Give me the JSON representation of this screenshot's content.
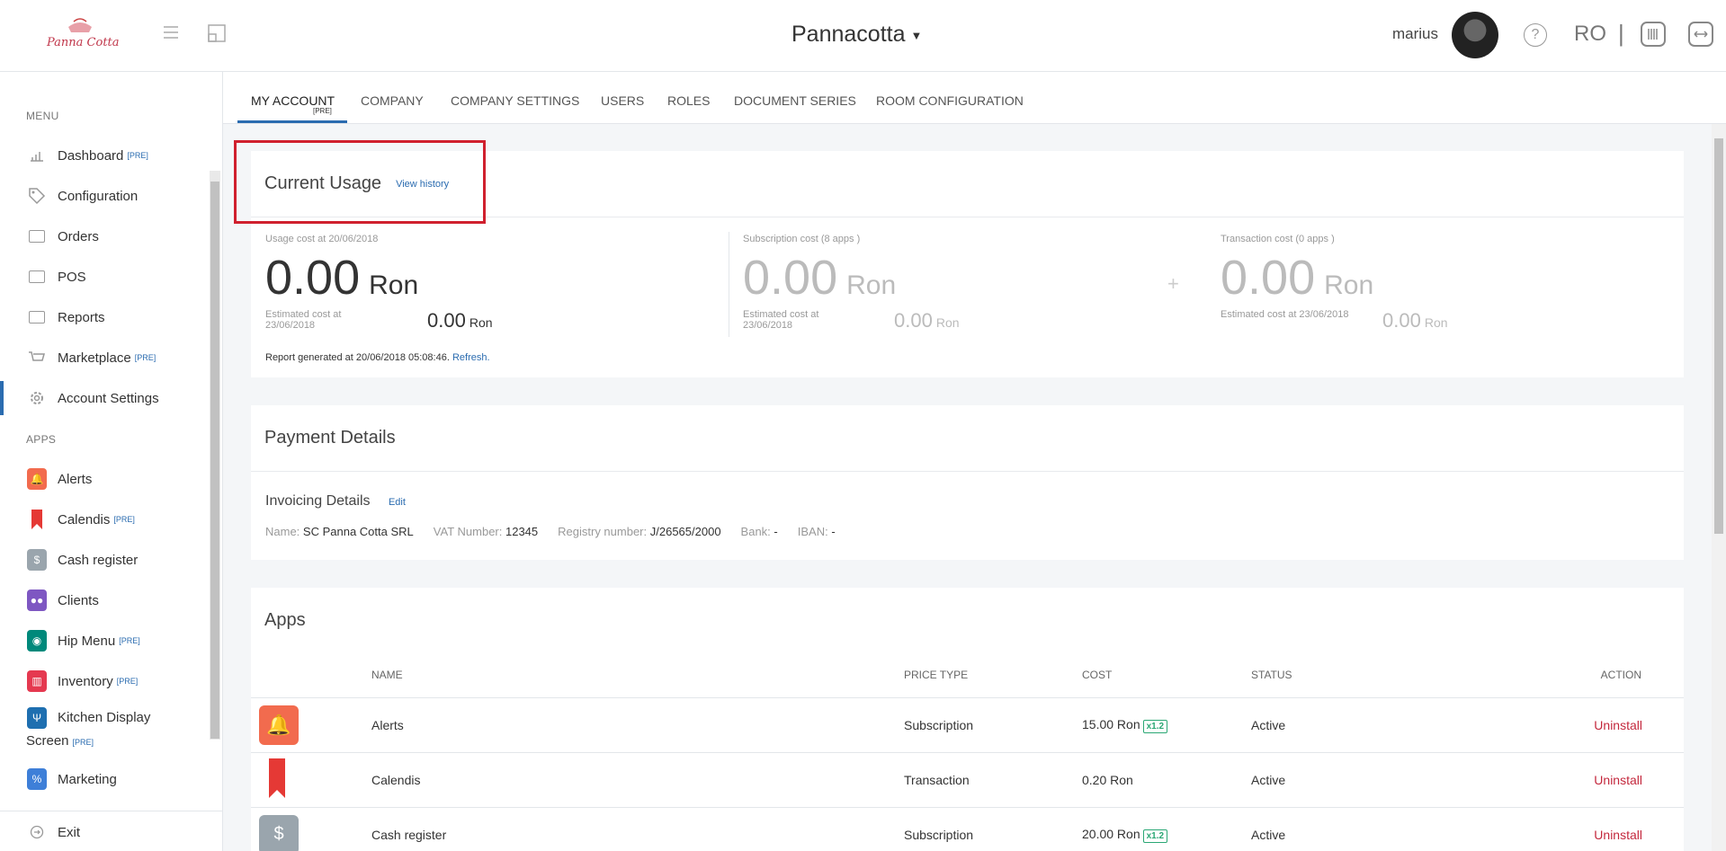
{
  "header": {
    "title": "Pannacotta",
    "user": "marius",
    "language": "RO",
    "separator": "|"
  },
  "sidebar": {
    "menu_label": "MENU",
    "apps_label": "APPS",
    "pre_tag": "[PRE]",
    "menu_items": [
      {
        "label": "Dashboard",
        "pre": true,
        "icon": "chart-icon"
      },
      {
        "label": "Configuration",
        "pre": false,
        "icon": "tag-icon"
      },
      {
        "label": "Orders",
        "pre": false,
        "icon": "orders-icon"
      },
      {
        "label": "POS",
        "pre": false,
        "icon": "pos-icon"
      },
      {
        "label": "Reports",
        "pre": false,
        "icon": "reports-icon"
      },
      {
        "label": "Marketplace",
        "pre": true,
        "icon": "cart-icon"
      },
      {
        "label": "Account Settings",
        "pre": false,
        "icon": "gear-icon",
        "active": true
      }
    ],
    "app_items": [
      {
        "label": "Alerts",
        "pre": false,
        "color": "#f26b4e"
      },
      {
        "label": "Calendis",
        "pre": true,
        "color": "#e53935"
      },
      {
        "label": "Cash register",
        "pre": false,
        "color": "#9aa5ad"
      },
      {
        "label": "Clients",
        "pre": false,
        "color": "#7e57c2"
      },
      {
        "label": "Hip Menu",
        "pre": true,
        "color": "#00897b"
      },
      {
        "label": "Inventory",
        "pre": true,
        "color": "#e53950"
      },
      {
        "label": "Kitchen Display",
        "label2": "Screen",
        "pre": true,
        "color": "#1e6fb0"
      },
      {
        "label": "Marketing",
        "pre": false,
        "color": "#3e7fd8"
      }
    ],
    "exit_label": "Exit"
  },
  "tabs": {
    "items": [
      "MY ACCOUNT",
      "COMPANY",
      "COMPANY SETTINGS",
      "USERS",
      "ROLES",
      "DOCUMENT SERIES",
      "ROOM CONFIGURATION"
    ],
    "active_pre": "[PRE]"
  },
  "usage": {
    "title": "Current Usage",
    "history_link": "View history",
    "usage_label": "Usage cost at 20/06/2018",
    "usage_value": "0.00",
    "unit": "Ron",
    "usage_est_label": "Estimated cost at 23/06/2018",
    "usage_est_value": "0.00",
    "sub_label": "Subscription cost (8 apps )",
    "sub_value": "0.00",
    "sub_est_label": "Estimated cost at 23/06/2018",
    "sub_est_value": "0.00",
    "plus": "+",
    "trans_label": "Transaction cost (0 apps )",
    "trans_value": "0.00",
    "trans_est_label": "Estimated cost at 23/06/2018",
    "trans_est_value": "0.00",
    "report_text": "Report generated at 20/06/2018 05:08:46.",
    "refresh": "Refresh."
  },
  "payment": {
    "title": "Payment Details",
    "invoicing_title": "Invoicing Details",
    "edit": "Edit",
    "name_label": "Name:",
    "name_value": "SC Panna Cotta SRL",
    "vat_label": "VAT Number:",
    "vat_value": "12345",
    "reg_label": "Registry number:",
    "reg_value": "J/26565/2000",
    "bank_label": "Bank:",
    "bank_value": "-",
    "iban_label": "IBAN:",
    "iban_value": "-"
  },
  "apps": {
    "title": "Apps",
    "columns": {
      "name": "NAME",
      "price_type": "PRICE TYPE",
      "cost": "COST",
      "status": "STATUS",
      "action": "ACTION"
    },
    "rows": [
      {
        "name": "Alerts",
        "price_type": "Subscription",
        "cost": "15.00 Ron",
        "multiplier": "x1.2",
        "status": "Active",
        "action": "Uninstall",
        "color": "#f26b4e"
      },
      {
        "name": "Calendis",
        "price_type": "Transaction",
        "cost": "0.20 Ron",
        "multiplier": "",
        "status": "Active",
        "action": "Uninstall",
        "color": "#e53935"
      },
      {
        "name": "Cash register",
        "price_type": "Subscription",
        "cost": "20.00 Ron",
        "multiplier": "x1.2",
        "status": "Active",
        "action": "Uninstall",
        "color": "#9aa5ad"
      }
    ]
  }
}
